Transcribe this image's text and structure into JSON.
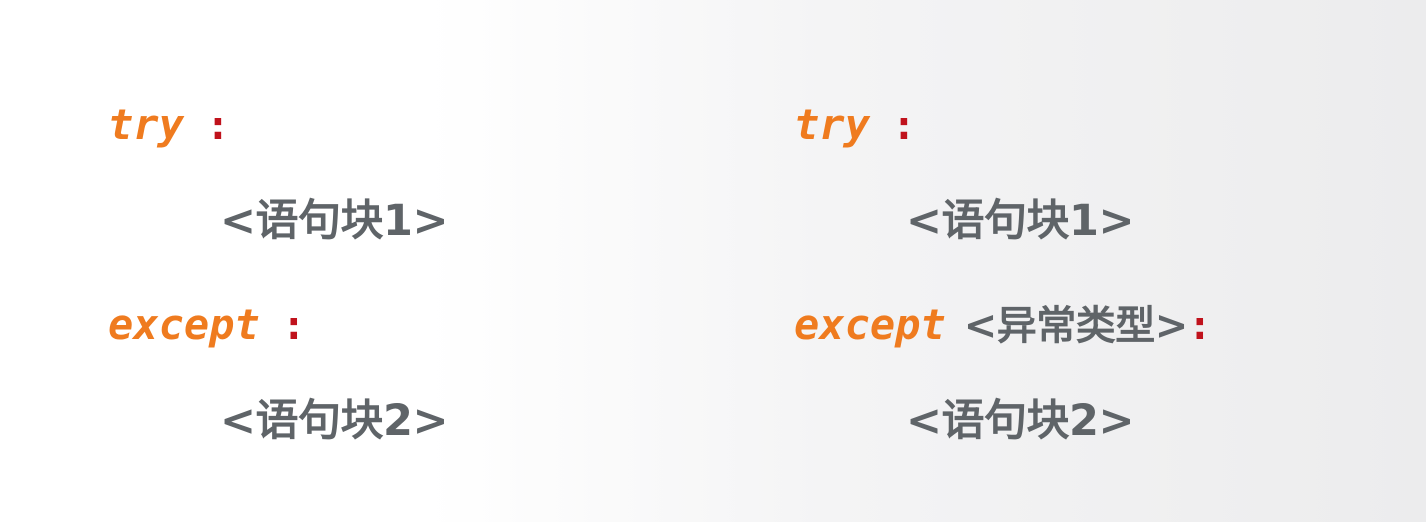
{
  "left": {
    "try_keyword": "try",
    "try_colon": ":",
    "block1": "<语句块1>",
    "except_keyword": "except",
    "except_colon": ":",
    "block2": "<语句块2>"
  },
  "right": {
    "try_keyword": "try",
    "try_colon": ":",
    "block1": "<语句块1>",
    "except_keyword": "except",
    "exception_type": "<异常类型>",
    "except_colon": ":",
    "block2": "<语句块2>"
  },
  "colors": {
    "keyword": "#ef7b1f",
    "colon": "#c0121c",
    "block_text": "#5f6468"
  }
}
